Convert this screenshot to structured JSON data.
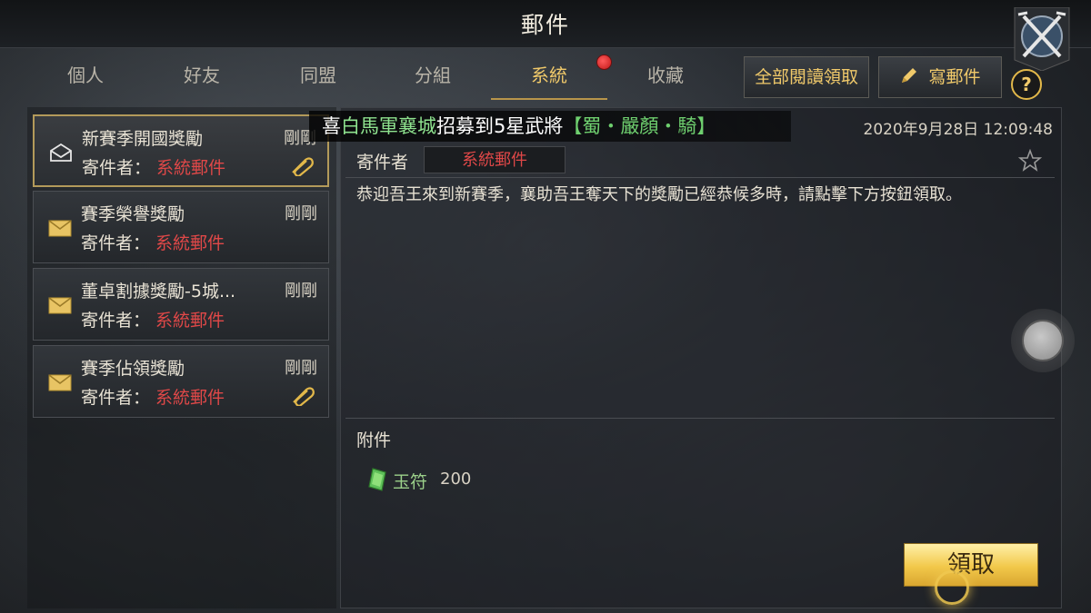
{
  "header": {
    "title": "郵件"
  },
  "tabs": [
    {
      "label": "個人",
      "active": false
    },
    {
      "label": "好友",
      "active": false
    },
    {
      "label": "同盟",
      "active": false
    },
    {
      "label": "分組",
      "active": false
    },
    {
      "label": "系統",
      "active": true,
      "has_notification": true
    },
    {
      "label": "收藏",
      "active": false
    }
  ],
  "toolbar": {
    "read_all_label": "全部閱讀領取",
    "compose_label": "寫郵件",
    "help_label": "?"
  },
  "mail_list": [
    {
      "title": "新賽季開國獎勵",
      "time": "剛剛",
      "sender_label": "寄件者：",
      "sender": "系統郵件",
      "selected": true,
      "opened": true,
      "has_attachment": true
    },
    {
      "title": "賽季榮譽獎勵",
      "time": "剛剛",
      "sender_label": "寄件者：",
      "sender": "系統郵件",
      "selected": false,
      "opened": false,
      "has_attachment": false
    },
    {
      "title": "董卓割據獎勵-5城...",
      "time": "剛剛",
      "sender_label": "寄件者：",
      "sender": "系統郵件",
      "selected": false,
      "opened": false,
      "has_attachment": false
    },
    {
      "title": "賽季佔領獎勵",
      "time": "剛剛",
      "sender_label": "寄件者：",
      "sender": "系統郵件",
      "selected": false,
      "opened": false,
      "has_attachment": true
    }
  ],
  "broadcast": {
    "prefix": "喜",
    "name": "白馬軍襄城",
    "middle": "招募到5星武將",
    "hero": "【蜀・嚴顏・騎】"
  },
  "detail": {
    "datetime": "2020年9月28日 12:09:48",
    "sender_label": "寄件者",
    "sender": "系統郵件",
    "body": "恭迎吾王來到新賽季，襄助吾王奪天下的獎勵已經恭候多時，請點擊下方按鈕領取。",
    "attachments_label": "附件",
    "attachments": [
      {
        "name": "玉符",
        "count": "200",
        "icon": "jade-token-icon"
      }
    ],
    "claim_label": "領取"
  },
  "colors": {
    "accent_gold": "#f0c96a",
    "sender_red": "#e04848",
    "broadcast_green": "#8fe38f",
    "claim_button": "#f2c84a"
  }
}
